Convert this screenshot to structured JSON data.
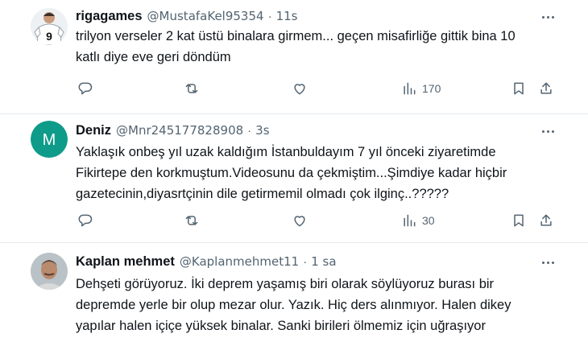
{
  "tweets": [
    {
      "name": "rigagames",
      "handle": "@MustafaKel95354",
      "separator": "·",
      "time": "11s",
      "avatar_label": "9",
      "lines": [
        "trilyon verseler 2 kat üstü binalara girmem... geçen misafirliğe gittik bina 10",
        "katlı diye eve geri döndüm"
      ],
      "views": "170"
    },
    {
      "name": "Deniz",
      "handle": "@Mnr245177828908",
      "separator": "·",
      "time": "3s",
      "avatar_label": "M",
      "avatar_color": "#0e9b8a",
      "lines": [
        "Yaklaşık onbeş yıl  uzak kaldığım İstanbuldayım 7 yıl önceki ziyaretimde",
        "Fikirtepe den korkmuştum.Videosunu da çekmiştim...Şimdiye kadar hiçbir",
        "gazetecinin,diyasrtçinin dile getirmemil olmadı çok ilginç..?????"
      ],
      "views": "30"
    },
    {
      "name": "Kaplan mehmet",
      "handle": "@Kaplanmehmet11",
      "separator": "·",
      "time": "1 sa",
      "lines": [
        "Dehşeti görüyoruz. İki deprem yaşamış biri olarak söylüyoruz burası bir",
        "depremde yerle bir olup mezar olur. Yazık. Hiç ders alınmıyor. Halen dikey",
        "yapılar halen içiçe yüksek binalar. Sanki birileri ölmemiz için uğraşıyor"
      ]
    }
  ]
}
